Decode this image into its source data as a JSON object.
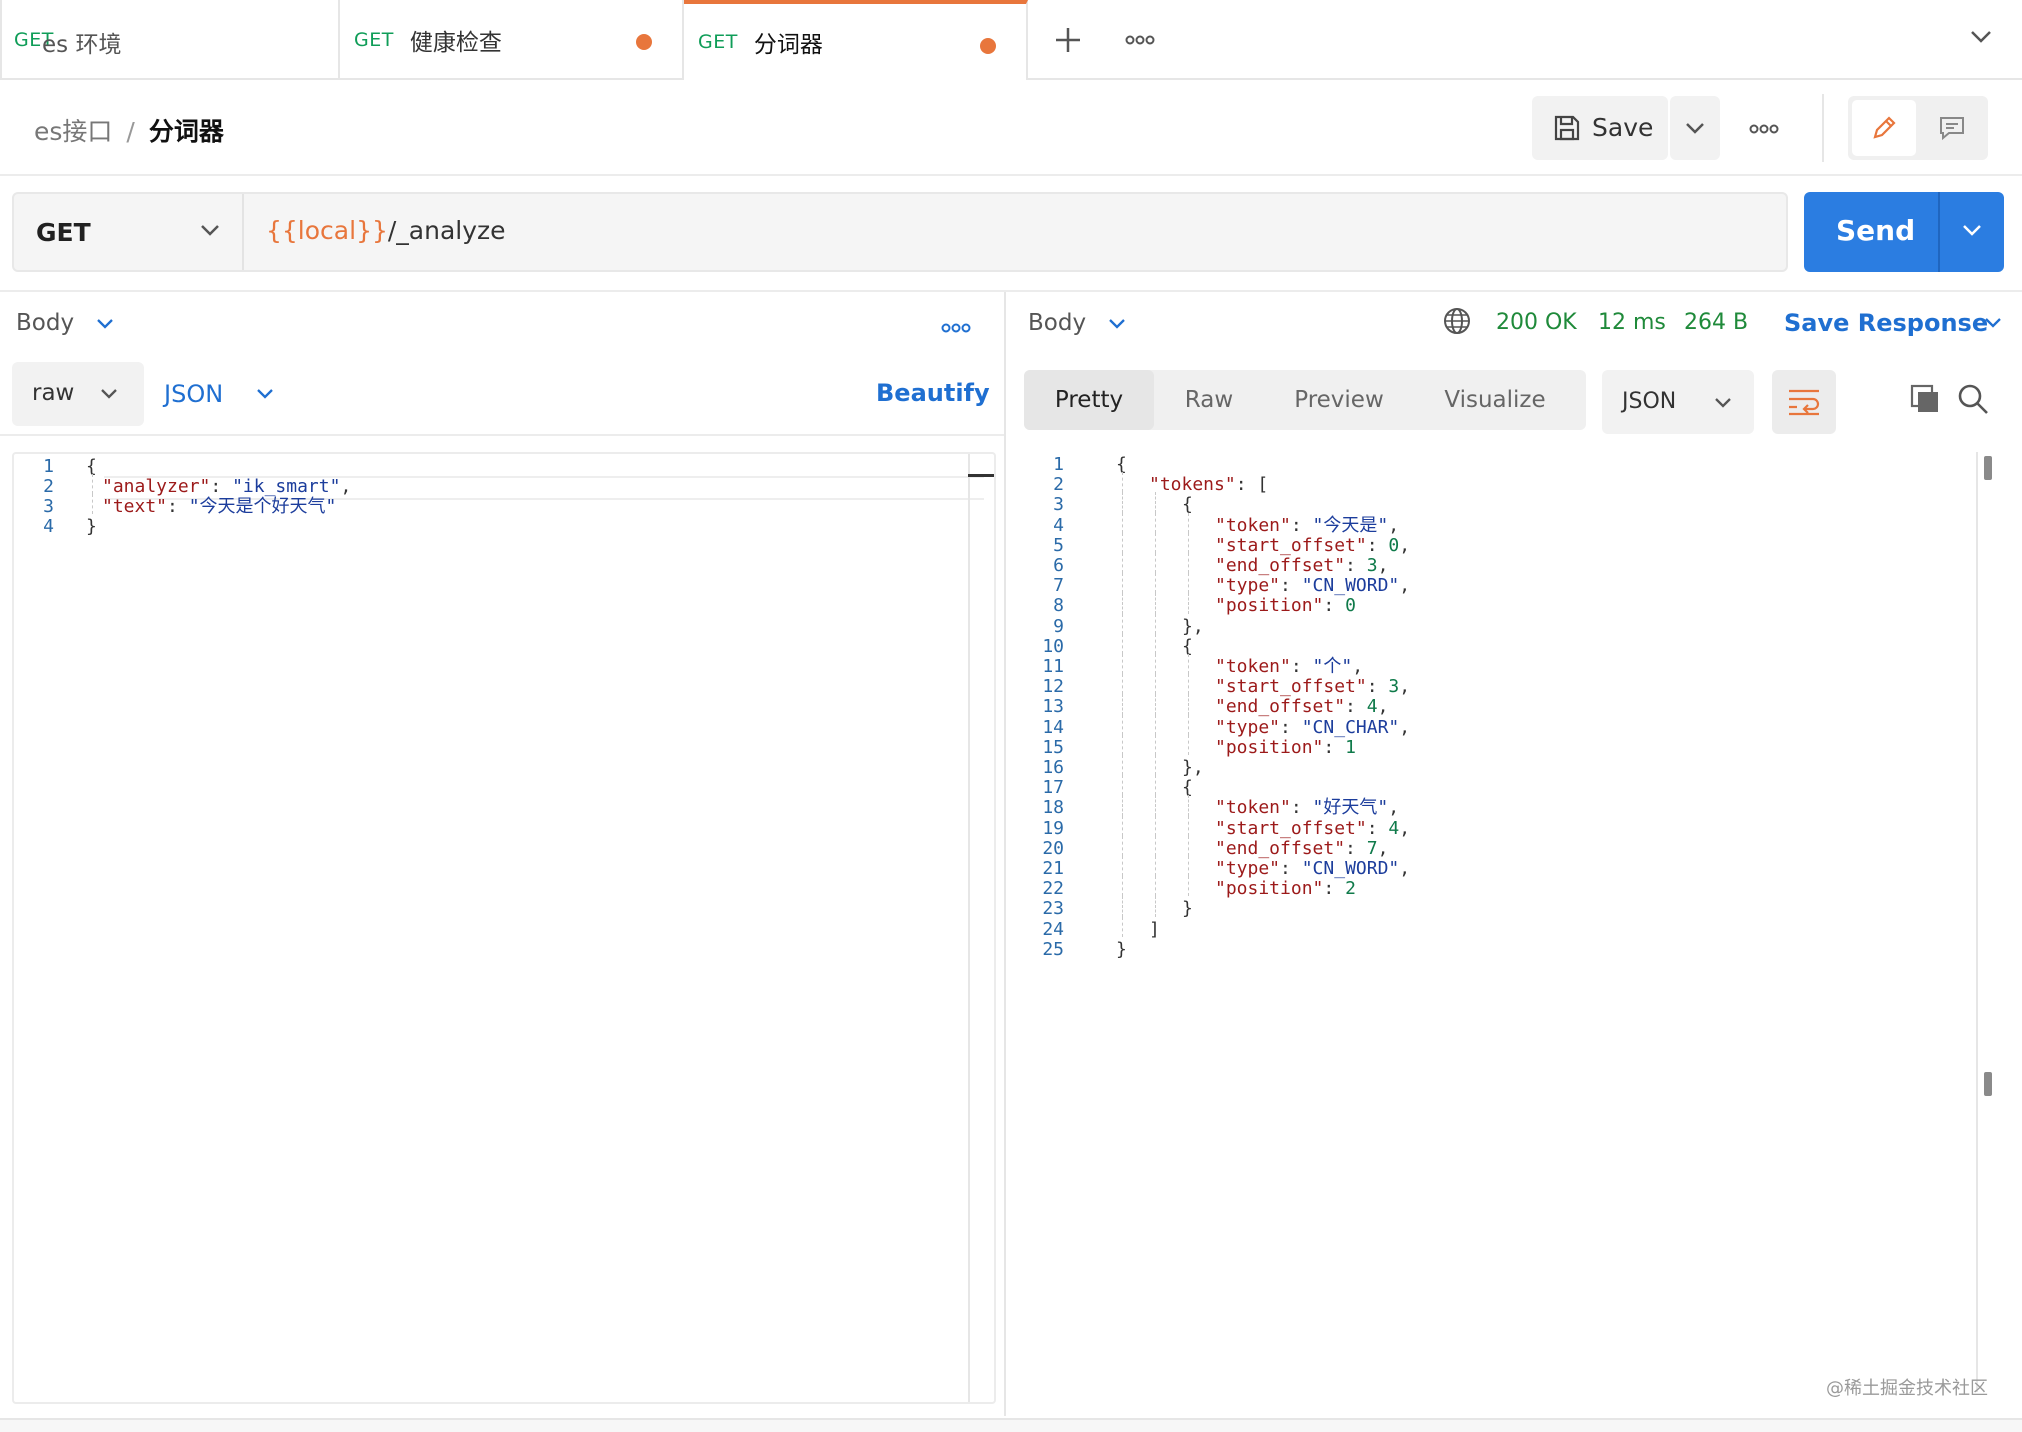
{
  "tabs": [
    {
      "method": "GET",
      "name": "",
      "unsaved": false,
      "active": false
    },
    {
      "method": "GET",
      "name": "健康检查",
      "unsaved": true,
      "active": false
    },
    {
      "method": "GET",
      "name": "分词器",
      "unsaved": true,
      "active": true
    }
  ],
  "environment": {
    "selected": "es 环境"
  },
  "breadcrumb": {
    "parent": "es接口",
    "separator": "/",
    "current": "分词器"
  },
  "toolbar": {
    "save_label": "Save"
  },
  "request": {
    "method": "GET",
    "url_variable": "{{local}}",
    "url_path": "/_analyze",
    "send_label": "Send",
    "body_label": "Body",
    "body_mode": "raw",
    "body_language": "JSON",
    "beautify_label": "Beautify",
    "body_lines": [
      {
        "num": "1",
        "indent": 0,
        "parts": [
          {
            "t": "{",
            "c": "p"
          }
        ]
      },
      {
        "num": "2",
        "indent": 1,
        "parts": [
          {
            "t": "\"analyzer\"",
            "c": "k"
          },
          {
            "t": ": ",
            "c": "p"
          },
          {
            "t": "\"ik_smart\"",
            "c": "s"
          },
          {
            "t": ",",
            "c": "p"
          }
        ]
      },
      {
        "num": "3",
        "indent": 1,
        "parts": [
          {
            "t": "\"text\"",
            "c": "k"
          },
          {
            "t": ": ",
            "c": "p"
          },
          {
            "t": "\"今天是个好天气\"",
            "c": "s"
          }
        ]
      },
      {
        "num": "4",
        "indent": 0,
        "parts": [
          {
            "t": "}",
            "c": "p"
          }
        ]
      }
    ]
  },
  "response": {
    "body_label": "Body",
    "status": "200 OK",
    "time": "12 ms",
    "size": "264 B",
    "save_response_label": "Save Response",
    "view_tabs": [
      "Pretty",
      "Raw",
      "Preview",
      "Visualize"
    ],
    "active_view": "Pretty",
    "format": "JSON",
    "body_lines": [
      {
        "num": "1",
        "indent": 0,
        "parts": [
          {
            "t": "{",
            "c": "p"
          }
        ]
      },
      {
        "num": "2",
        "indent": 1,
        "parts": [
          {
            "t": "\"tokens\"",
            "c": "k"
          },
          {
            "t": ": [",
            "c": "p"
          }
        ]
      },
      {
        "num": "3",
        "indent": 2,
        "parts": [
          {
            "t": "{",
            "c": "p"
          }
        ]
      },
      {
        "num": "4",
        "indent": 3,
        "parts": [
          {
            "t": "\"token\"",
            "c": "k"
          },
          {
            "t": ": ",
            "c": "p"
          },
          {
            "t": "\"今天是\"",
            "c": "s"
          },
          {
            "t": ",",
            "c": "p"
          }
        ]
      },
      {
        "num": "5",
        "indent": 3,
        "parts": [
          {
            "t": "\"start_offset\"",
            "c": "k"
          },
          {
            "t": ": ",
            "c": "p"
          },
          {
            "t": "0",
            "c": "n"
          },
          {
            "t": ",",
            "c": "p"
          }
        ]
      },
      {
        "num": "6",
        "indent": 3,
        "parts": [
          {
            "t": "\"end_offset\"",
            "c": "k"
          },
          {
            "t": ": ",
            "c": "p"
          },
          {
            "t": "3",
            "c": "n"
          },
          {
            "t": ",",
            "c": "p"
          }
        ]
      },
      {
        "num": "7",
        "indent": 3,
        "parts": [
          {
            "t": "\"type\"",
            "c": "k"
          },
          {
            "t": ": ",
            "c": "p"
          },
          {
            "t": "\"CN_WORD\"",
            "c": "s"
          },
          {
            "t": ",",
            "c": "p"
          }
        ]
      },
      {
        "num": "8",
        "indent": 3,
        "parts": [
          {
            "t": "\"position\"",
            "c": "k"
          },
          {
            "t": ": ",
            "c": "p"
          },
          {
            "t": "0",
            "c": "n"
          }
        ]
      },
      {
        "num": "9",
        "indent": 2,
        "parts": [
          {
            "t": "},",
            "c": "p"
          }
        ]
      },
      {
        "num": "10",
        "indent": 2,
        "parts": [
          {
            "t": "{",
            "c": "p"
          }
        ]
      },
      {
        "num": "11",
        "indent": 3,
        "parts": [
          {
            "t": "\"token\"",
            "c": "k"
          },
          {
            "t": ": ",
            "c": "p"
          },
          {
            "t": "\"个\"",
            "c": "s"
          },
          {
            "t": ",",
            "c": "p"
          }
        ]
      },
      {
        "num": "12",
        "indent": 3,
        "parts": [
          {
            "t": "\"start_offset\"",
            "c": "k"
          },
          {
            "t": ": ",
            "c": "p"
          },
          {
            "t": "3",
            "c": "n"
          },
          {
            "t": ",",
            "c": "p"
          }
        ]
      },
      {
        "num": "13",
        "indent": 3,
        "parts": [
          {
            "t": "\"end_offset\"",
            "c": "k"
          },
          {
            "t": ": ",
            "c": "p"
          },
          {
            "t": "4",
            "c": "n"
          },
          {
            "t": ",",
            "c": "p"
          }
        ]
      },
      {
        "num": "14",
        "indent": 3,
        "parts": [
          {
            "t": "\"type\"",
            "c": "k"
          },
          {
            "t": ": ",
            "c": "p"
          },
          {
            "t": "\"CN_CHAR\"",
            "c": "s"
          },
          {
            "t": ",",
            "c": "p"
          }
        ]
      },
      {
        "num": "15",
        "indent": 3,
        "parts": [
          {
            "t": "\"position\"",
            "c": "k"
          },
          {
            "t": ": ",
            "c": "p"
          },
          {
            "t": "1",
            "c": "n"
          }
        ]
      },
      {
        "num": "16",
        "indent": 2,
        "parts": [
          {
            "t": "},",
            "c": "p"
          }
        ]
      },
      {
        "num": "17",
        "indent": 2,
        "parts": [
          {
            "t": "{",
            "c": "p"
          }
        ]
      },
      {
        "num": "18",
        "indent": 3,
        "parts": [
          {
            "t": "\"token\"",
            "c": "k"
          },
          {
            "t": ": ",
            "c": "p"
          },
          {
            "t": "\"好天气\"",
            "c": "s"
          },
          {
            "t": ",",
            "c": "p"
          }
        ]
      },
      {
        "num": "19",
        "indent": 3,
        "parts": [
          {
            "t": "\"start_offset\"",
            "c": "k"
          },
          {
            "t": ": ",
            "c": "p"
          },
          {
            "t": "4",
            "c": "n"
          },
          {
            "t": ",",
            "c": "p"
          }
        ]
      },
      {
        "num": "20",
        "indent": 3,
        "parts": [
          {
            "t": "\"end_offset\"",
            "c": "k"
          },
          {
            "t": ": ",
            "c": "p"
          },
          {
            "t": "7",
            "c": "n"
          },
          {
            "t": ",",
            "c": "p"
          }
        ]
      },
      {
        "num": "21",
        "indent": 3,
        "parts": [
          {
            "t": "\"type\"",
            "c": "k"
          },
          {
            "t": ": ",
            "c": "p"
          },
          {
            "t": "\"CN_WORD\"",
            "c": "s"
          },
          {
            "t": ",",
            "c": "p"
          }
        ]
      },
      {
        "num": "22",
        "indent": 3,
        "parts": [
          {
            "t": "\"position\"",
            "c": "k"
          },
          {
            "t": ": ",
            "c": "p"
          },
          {
            "t": "2",
            "c": "n"
          }
        ]
      },
      {
        "num": "23",
        "indent": 2,
        "parts": [
          {
            "t": "}",
            "c": "p"
          }
        ]
      },
      {
        "num": "24",
        "indent": 1,
        "parts": [
          {
            "t": "]",
            "c": "p"
          }
        ]
      },
      {
        "num": "25",
        "indent": 0,
        "parts": [
          {
            "t": "}",
            "c": "p"
          }
        ]
      }
    ]
  },
  "watermark": "@稀土掘金技术社区",
  "colors": {
    "accent": "#e8763c",
    "send": "#2b7de1",
    "link": "#1f6fd1",
    "success": "#1f8a3a",
    "get_method": "#0f9d58"
  }
}
